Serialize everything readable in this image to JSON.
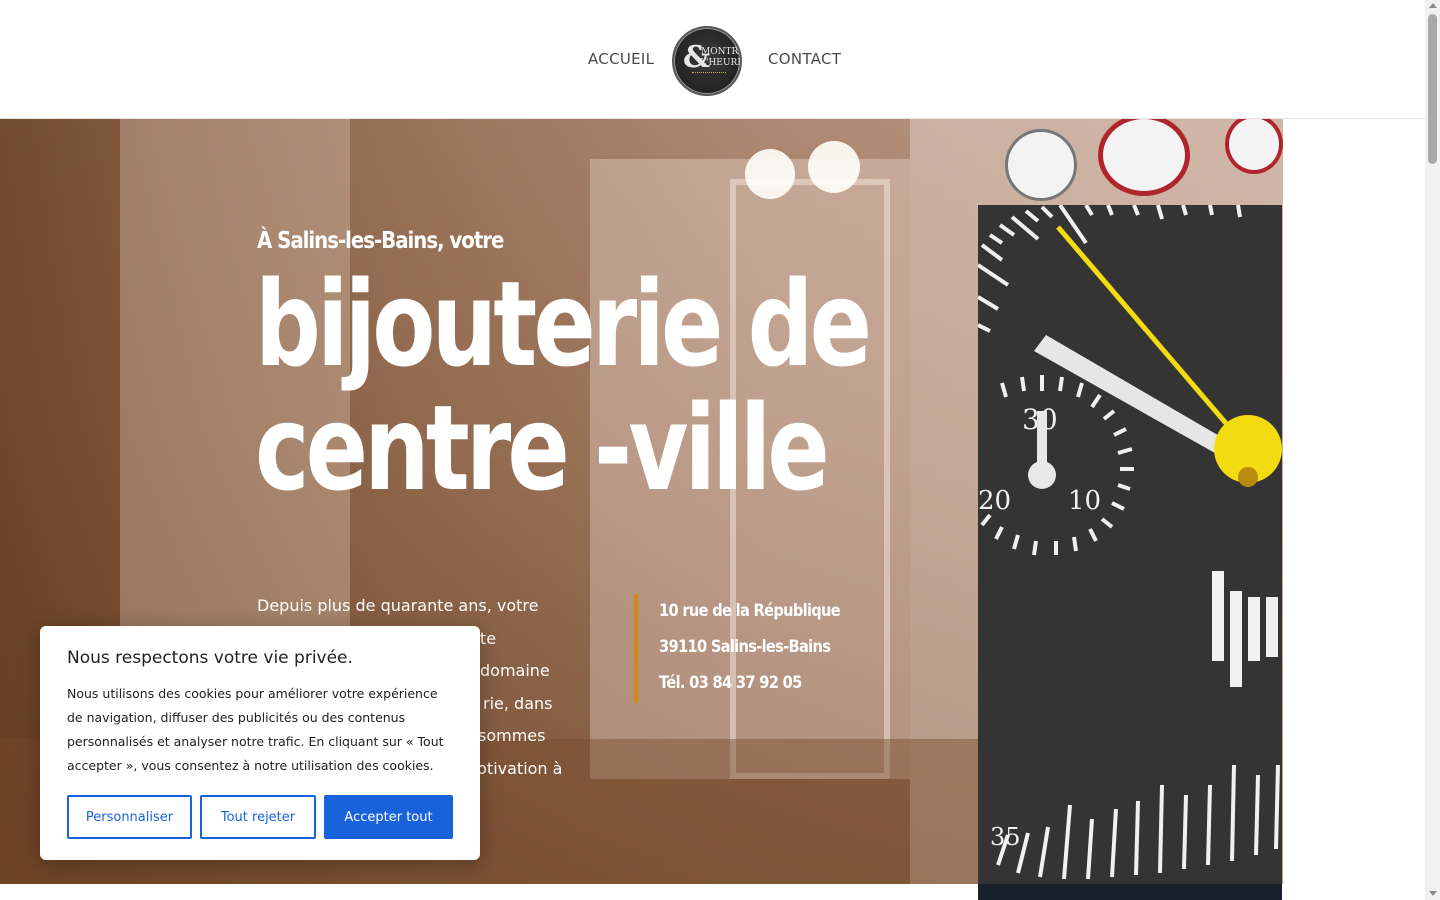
{
  "nav": {
    "accueil": "ACCUEIL",
    "contact": "CONTACT",
    "logo_ampersand": "&",
    "logo_line1": "MONTRE",
    "logo_line2": "L'HEURE"
  },
  "hero": {
    "kicker": "À Salins-les-Bains, votre",
    "title_line1": "bijouterie de",
    "title_line2": "centre -ville",
    "description_lines": [
      "Depuis plus de quarante ans, votre",
      "cette",
      "domaine",
      "rie, dans",
      "sommes",
      "notivation à"
    ],
    "address_line1": "10 rue de la République",
    "address_line2": "39110 Salins-les-Bains",
    "address_phone": "Tél. 03 84 37 92 05",
    "clock_numbers": [
      "30",
      "20",
      "10",
      "35"
    ]
  },
  "cookie": {
    "title": "Nous respectons votre vie privée.",
    "text": "Nous utilisons des cookies pour améliorer votre expérience de navigation, diffuser des publicités ou des contenus personnalisés et analyser notre trafic. En cliquant sur « Tout accepter », vous consentez à notre utilisation des cookies.",
    "btn_customize": "Personnaliser",
    "btn_reject": "Tout rejeter",
    "btn_accept": "Accepter tout"
  },
  "colors": {
    "accent_blue": "#1863dc",
    "address_bar": "#d18a1a",
    "clock_hand_yellow": "#f2dc11",
    "clock_face": "#343434"
  }
}
